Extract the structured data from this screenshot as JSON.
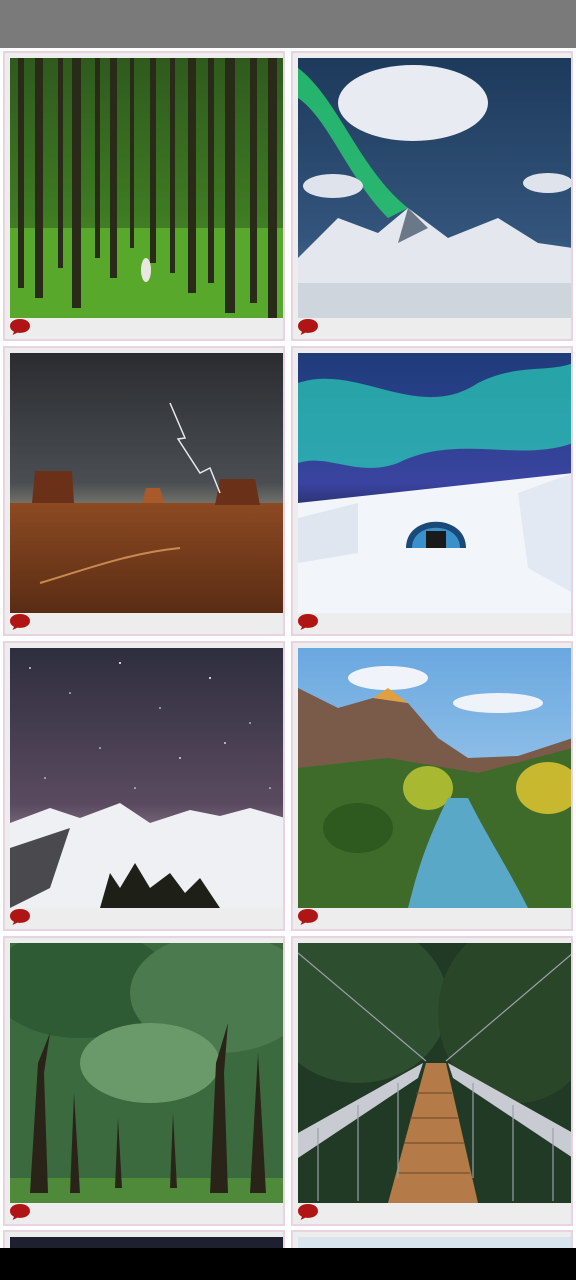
{
  "app": {
    "title": ""
  },
  "gallery": {
    "items": [
      {
        "name": "forest-photo",
        "comment_icon": "speech-bubble-icon"
      },
      {
        "name": "aurora-mountain-photo",
        "comment_icon": "speech-bubble-icon"
      },
      {
        "name": "desert-storm-photo",
        "comment_icon": "speech-bubble-icon"
      },
      {
        "name": "ice-hotel-aurora-photo",
        "comment_icon": "speech-bubble-icon"
      },
      {
        "name": "starry-snow-mountain-photo",
        "comment_icon": "speech-bubble-icon"
      },
      {
        "name": "canyon-river-photo",
        "comment_icon": "speech-bubble-icon"
      },
      {
        "name": "tree-avenue-photo",
        "comment_icon": "speech-bubble-icon"
      },
      {
        "name": "suspension-bridge-photo",
        "comment_icon": "speech-bubble-icon"
      }
    ]
  },
  "colors": {
    "topbar": "#7a7a7a",
    "card_bg": "#ededed",
    "card_border": "#e8d3e0",
    "comment_icon": "#b01515"
  }
}
